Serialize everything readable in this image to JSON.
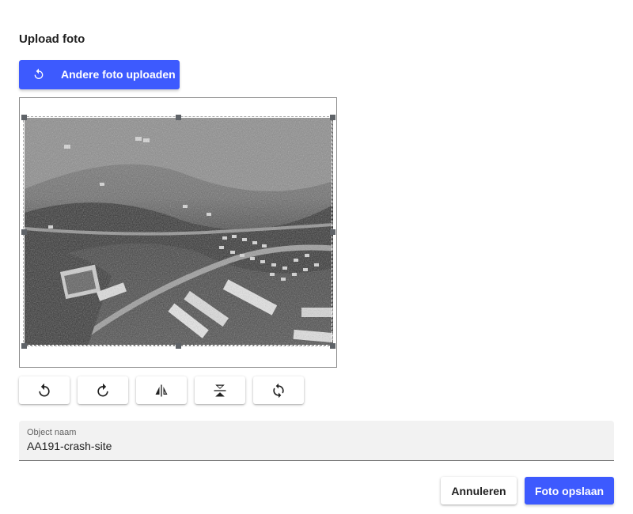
{
  "dialog": {
    "title": "Upload foto",
    "upload_button": {
      "label": "Andere foto uploaden",
      "icon": "rotate-left-icon"
    },
    "image": {
      "subject": "aerial black-and-white photo"
    },
    "tools": [
      {
        "name": "rotate-left-button",
        "icon": "rotate-left-icon"
      },
      {
        "name": "rotate-right-button",
        "icon": "rotate-right-icon"
      },
      {
        "name": "flip-horizontal-button",
        "icon": "flip-horizontal-icon"
      },
      {
        "name": "flip-vertical-button",
        "icon": "flip-vertical-icon"
      },
      {
        "name": "reset-button",
        "icon": "sync-icon"
      }
    ],
    "object_field": {
      "label": "Object naam",
      "value": "AA191-crash-site"
    },
    "cancel_label": "Annuleren",
    "save_label": "Foto opslaan"
  },
  "colors": {
    "primary": "#3d5afe",
    "field_bg": "#f2f2f2"
  }
}
